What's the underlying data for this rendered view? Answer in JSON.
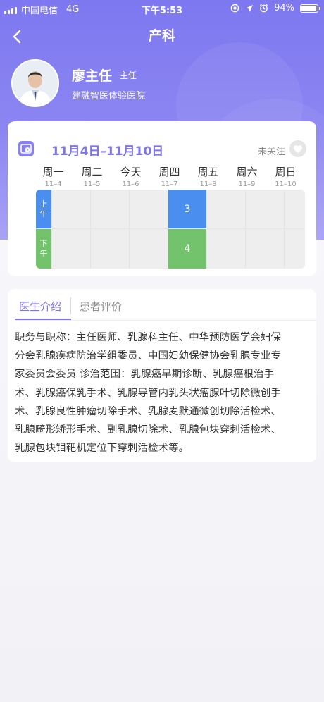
{
  "status_bar": {
    "carrier": "中国电信",
    "network": "4G",
    "time": "下午5:53",
    "battery": "94%",
    "battery_level": 0.94
  },
  "nav": {
    "title": "产科"
  },
  "doctor": {
    "name": "廖主任",
    "title": "主任",
    "hospital": "建融智医体验医院"
  },
  "schedule": {
    "date_range": "11月4日–11月10日",
    "follow_label": "未关注",
    "days": [
      {
        "name": "周一",
        "date": "11–4"
      },
      {
        "name": "周二",
        "date": "11–5"
      },
      {
        "name": "今天",
        "date": "11–6"
      },
      {
        "name": "周四",
        "date": "11–7"
      },
      {
        "name": "周五",
        "date": "11–8"
      },
      {
        "name": "周六",
        "date": "11–9"
      },
      {
        "name": "周日",
        "date": "11–10"
      }
    ],
    "am_label_1": "上",
    "am_label_2": "午",
    "pm_label_1": "下",
    "pm_label_2": "午",
    "am_slots": [
      "",
      "",
      "",
      "3",
      "",
      "",
      ""
    ],
    "pm_slots": [
      "",
      "",
      "",
      "4",
      "",
      "",
      ""
    ],
    "am_color": "#4a8ef0",
    "pm_color": "#72c36c"
  },
  "info": {
    "tabs": [
      {
        "label": "医生介绍"
      },
      {
        "label": "患者评价"
      }
    ],
    "intro_lines": [
      "职务与职称：主任医师、乳腺科主任、中华预防医学会妇保",
      "分会乳腺疾病防治学组委员、中国妇幼保健协会乳腺专业专",
      "家委员会委员 诊治范围：乳腺癌早期诊断、乳腺癌根治手",
      "术、乳腺癌保乳手术、乳腺导管内乳头状瘤腺叶切除微创手",
      "术、乳腺良性肿瘤切除手术、乳腺麦默通微创切除活检术、",
      "乳腺畸形矫形手术、副乳腺切除术、乳腺包块穿刺活检术、",
      "乳腺包块钼靶机定位下穿刺活检术等。"
    ]
  },
  "colors": {
    "header_purple": "#7d78f0",
    "accent": "#7d74e8"
  }
}
